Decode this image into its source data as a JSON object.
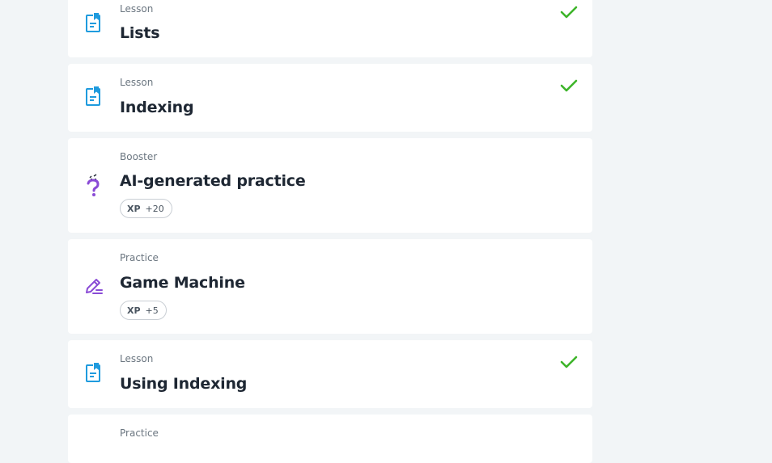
{
  "colors": {
    "page_background": "#f2f5f7",
    "card_background": "#ffffff",
    "lesson_icon": "#1f9bde",
    "booster_icon": "#8a4bd6",
    "practice_icon": "#8a4bd6",
    "check": "#3db42a",
    "title_text": "#1e2733",
    "type_text": "#6b7680"
  },
  "items": [
    {
      "type": "Lesson",
      "title": "Lists",
      "icon": "lesson-document-icon",
      "completed": true
    },
    {
      "type": "Lesson",
      "title": "Indexing",
      "icon": "lesson-document-icon",
      "completed": true
    },
    {
      "type": "Booster",
      "title": "AI-generated practice",
      "icon": "question-mark-icon",
      "completed": false,
      "xp_label": "XP",
      "xp_value": "+20"
    },
    {
      "type": "Practice",
      "title": "Game Machine",
      "icon": "pencil-icon",
      "completed": false,
      "xp_label": "XP",
      "xp_value": "+5"
    },
    {
      "type": "Lesson",
      "title": "Using Indexing",
      "icon": "lesson-document-icon",
      "completed": true
    },
    {
      "type": "Practice",
      "title": "",
      "icon": "pencil-icon",
      "completed": false
    }
  ]
}
